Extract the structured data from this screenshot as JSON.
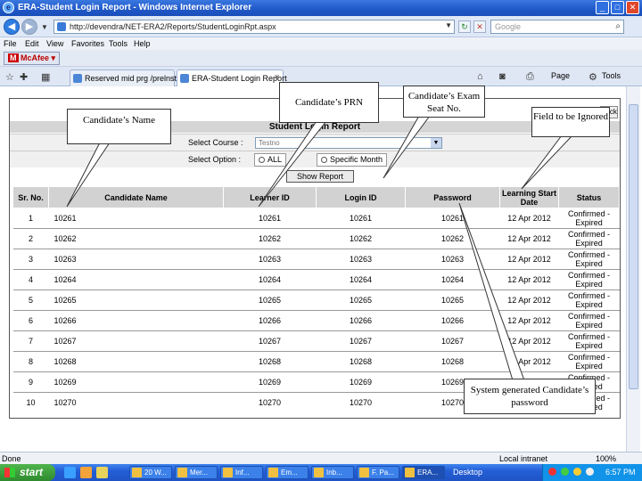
{
  "window": {
    "title": "ERA-Student Login Report - Windows Internet Explorer",
    "min": "_",
    "max": "□",
    "close": "✕"
  },
  "address": {
    "url": "http://devendra/NET-ERA2/Reports/StudentLoginRpt.aspx",
    "search_placeholder": "Google"
  },
  "menu": [
    "File",
    "Edit",
    "View",
    "Favorites",
    "Tools",
    "Help"
  ],
  "toolbar": {
    "mcafee": "McAfee",
    "tabs": [
      {
        "label": "Reserved mid prg /prelnst ..."
      },
      {
        "label": "ERA-Student Login Report"
      }
    ],
    "page": "Page",
    "tools": "Tools"
  },
  "report": {
    "title": "Student Login Report",
    "close_label": "Back",
    "course_label": "Select Course :",
    "course_value": "Testno",
    "option_label": "Select Option :",
    "option_all": "ALL",
    "option_specific": "Specific Month",
    "show_button": "Show Report",
    "columns": [
      "Sr. No.",
      "Candidate Name",
      "Learner ID",
      "Login ID",
      "Password",
      "Learning Start Date",
      "Status"
    ],
    "rows": [
      {
        "sr": "1",
        "name": "10261",
        "learner": "10261",
        "login": "10261",
        "password": "10261",
        "date": "12 Apr 2012",
        "status": "Confirmed - Expired"
      },
      {
        "sr": "2",
        "name": "10262",
        "learner": "10262",
        "login": "10262",
        "password": "10262",
        "date": "12 Apr 2012",
        "status": "Confirmed - Expired"
      },
      {
        "sr": "3",
        "name": "10263",
        "learner": "10263",
        "login": "10263",
        "password": "10263",
        "date": "12 Apr 2012",
        "status": "Confirmed - Expired"
      },
      {
        "sr": "4",
        "name": "10264",
        "learner": "10264",
        "login": "10264",
        "password": "10264",
        "date": "12 Apr 2012",
        "status": "Confirmed - Expired"
      },
      {
        "sr": "5",
        "name": "10265",
        "learner": "10265",
        "login": "10265",
        "password": "10265",
        "date": "12 Apr 2012",
        "status": "Confirmed - Expired"
      },
      {
        "sr": "6",
        "name": "10266",
        "learner": "10266",
        "login": "10266",
        "password": "10266",
        "date": "12 Apr 2012",
        "status": "Confirmed - Expired"
      },
      {
        "sr": "7",
        "name": "10267",
        "learner": "10267",
        "login": "10267",
        "password": "10267",
        "date": "12 Apr 2012",
        "status": "Confirmed - Expired"
      },
      {
        "sr": "8",
        "name": "10268",
        "learner": "10268",
        "login": "10268",
        "password": "10268",
        "date": "12 Apr 2012",
        "status": "Confirmed - Expired"
      },
      {
        "sr": "9",
        "name": "10269",
        "learner": "10269",
        "login": "10269",
        "password": "10269",
        "date": "12 Apr 2012",
        "status": "Confirmed - Expired"
      },
      {
        "sr": "10",
        "name": "10270",
        "learner": "10270",
        "login": "10270",
        "password": "10270",
        "date": "12 Apr 2012",
        "status": "Confirmed - Expired"
      }
    ]
  },
  "callouts": {
    "name": "Candidate’s Name",
    "prn": "Candidate’s PRN",
    "seat": "Candidate’s Exam Seat No.",
    "ignored": "Field to be Ignored",
    "password": "System generated Candidate’s password"
  },
  "status": {
    "done": "Done",
    "zone": "Local intranet",
    "zoom": "100%"
  },
  "taskbar": {
    "start": "start",
    "items": [
      "20 W...",
      "Mer...",
      "Inf...",
      "Em...",
      "Inb...",
      "F. Pa...",
      "ERA..."
    ],
    "desktop": "Desktop",
    "time": "6:57 PM"
  }
}
